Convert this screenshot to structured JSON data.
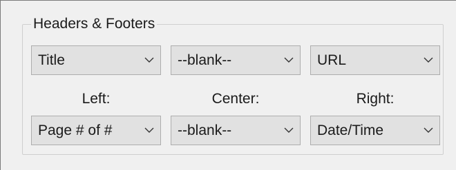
{
  "group": {
    "title": "Headers & Footers"
  },
  "headers": {
    "left": {
      "value": "Title"
    },
    "center": {
      "value": "--blank--"
    },
    "right": {
      "value": "URL"
    }
  },
  "labels": {
    "left": "Left:",
    "center": "Center:",
    "right": "Right:"
  },
  "footers": {
    "left": {
      "value": "Page # of #"
    },
    "center": {
      "value": "--blank--"
    },
    "right": {
      "value": "Date/Time"
    }
  },
  "icons": {
    "dropdown": "chevron-down-icon"
  }
}
